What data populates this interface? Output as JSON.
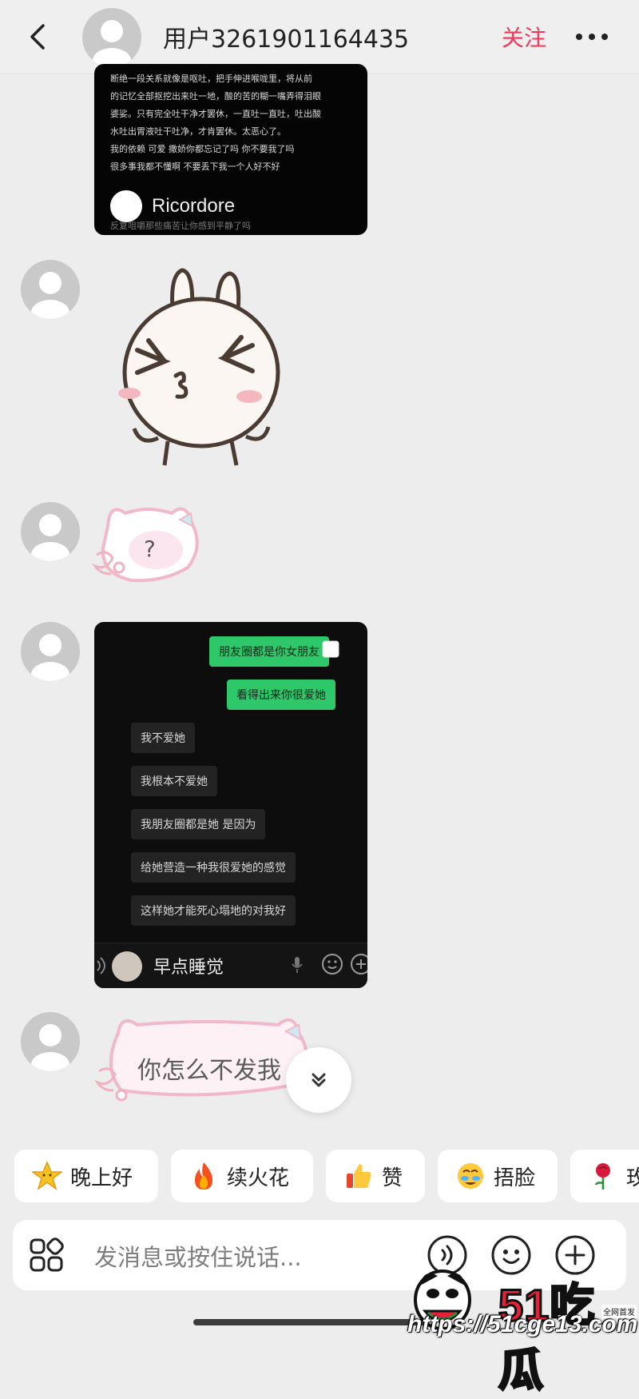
{
  "header": {
    "title": "用户3261901164435",
    "follow_label": "关注"
  },
  "messages": {
    "card1": {
      "lines": [
        "断绝一段关系就像是呕吐，把手伸进喉咙里，将从前",
        "的记忆全部抠挖出来吐一地，酸的苦的糊一嘴弄得泪眼",
        "婆娑。只有完全吐干净才罢休，一直吐一直吐，吐出酸",
        "水吐出胃液吐干吐净，才肯罢休。太恶心了。",
        "我的依赖 可爱 撒娇你都忘记了吗 你不要我了吗",
        "很多事我都不懂啊 不要丢下我一个人好不好"
      ],
      "watermark_name": "Ricordore",
      "faded_line": "反复咀嚼那些痛苦让你感到平静了吗"
    },
    "sticker_cat_text": "?",
    "card2": {
      "sent": [
        "朋友圈都是你女朋友",
        "看得出来你很爱她"
      ],
      "received": [
        "我不爱她",
        "我根本不爱她",
        "我朋友圈都是她 是因为",
        "给她营造一种我很爱她的感觉",
        "这样她才能死心塌地的对我好"
      ],
      "composer_name": "早点睡觉"
    },
    "sticker_cat2_text": "你怎么不发我"
  },
  "quick_replies": [
    {
      "label": "晚上好",
      "icon": "star-face-icon"
    },
    {
      "label": "续火花",
      "icon": "fire-icon"
    },
    {
      "label": "赞",
      "icon": "thumbs-up-icon"
    },
    {
      "label": "捂脸",
      "icon": "facepalm-icon"
    },
    {
      "label": "玫",
      "icon": "rose-icon"
    }
  ],
  "input": {
    "placeholder": "发消息或按住说话..."
  },
  "watermark": {
    "logo": "51吃瓜",
    "tag": "全网首发",
    "url": "https://51cge13.com"
  },
  "colors": {
    "accent": "#f0395a",
    "background": "#ededed",
    "wechat_green": "#2ec86b"
  }
}
